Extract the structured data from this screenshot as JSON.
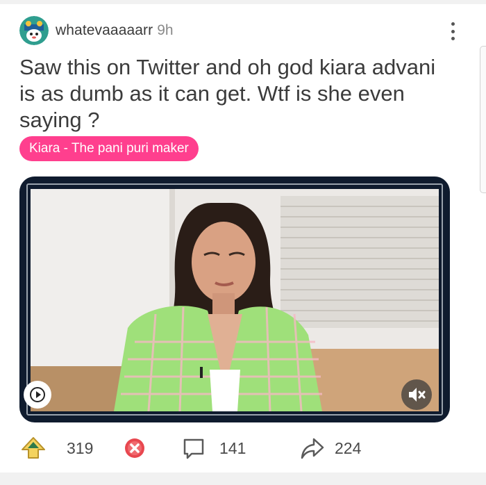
{
  "post": {
    "username": "whatevaaaaarr",
    "time": "9h",
    "title": "Saw this on Twitter and oh god kiara advani is as dumb as it can get. Wtf is she even saying ?",
    "flair": "Kiara - The pani puri maker"
  },
  "actions": {
    "upvotes": "319",
    "comments": "141",
    "shares": "224"
  },
  "colors": {
    "flair_bg": "#ff3f8e",
    "video_frame": "#0f1b2e",
    "downvote": "#e8474f",
    "upvote": "#e2b93b"
  },
  "icons": [
    "avatar",
    "more-options-icon",
    "play-icon",
    "mute-icon",
    "upvote-icon",
    "downvote-icon",
    "comment-icon",
    "share-icon"
  ]
}
